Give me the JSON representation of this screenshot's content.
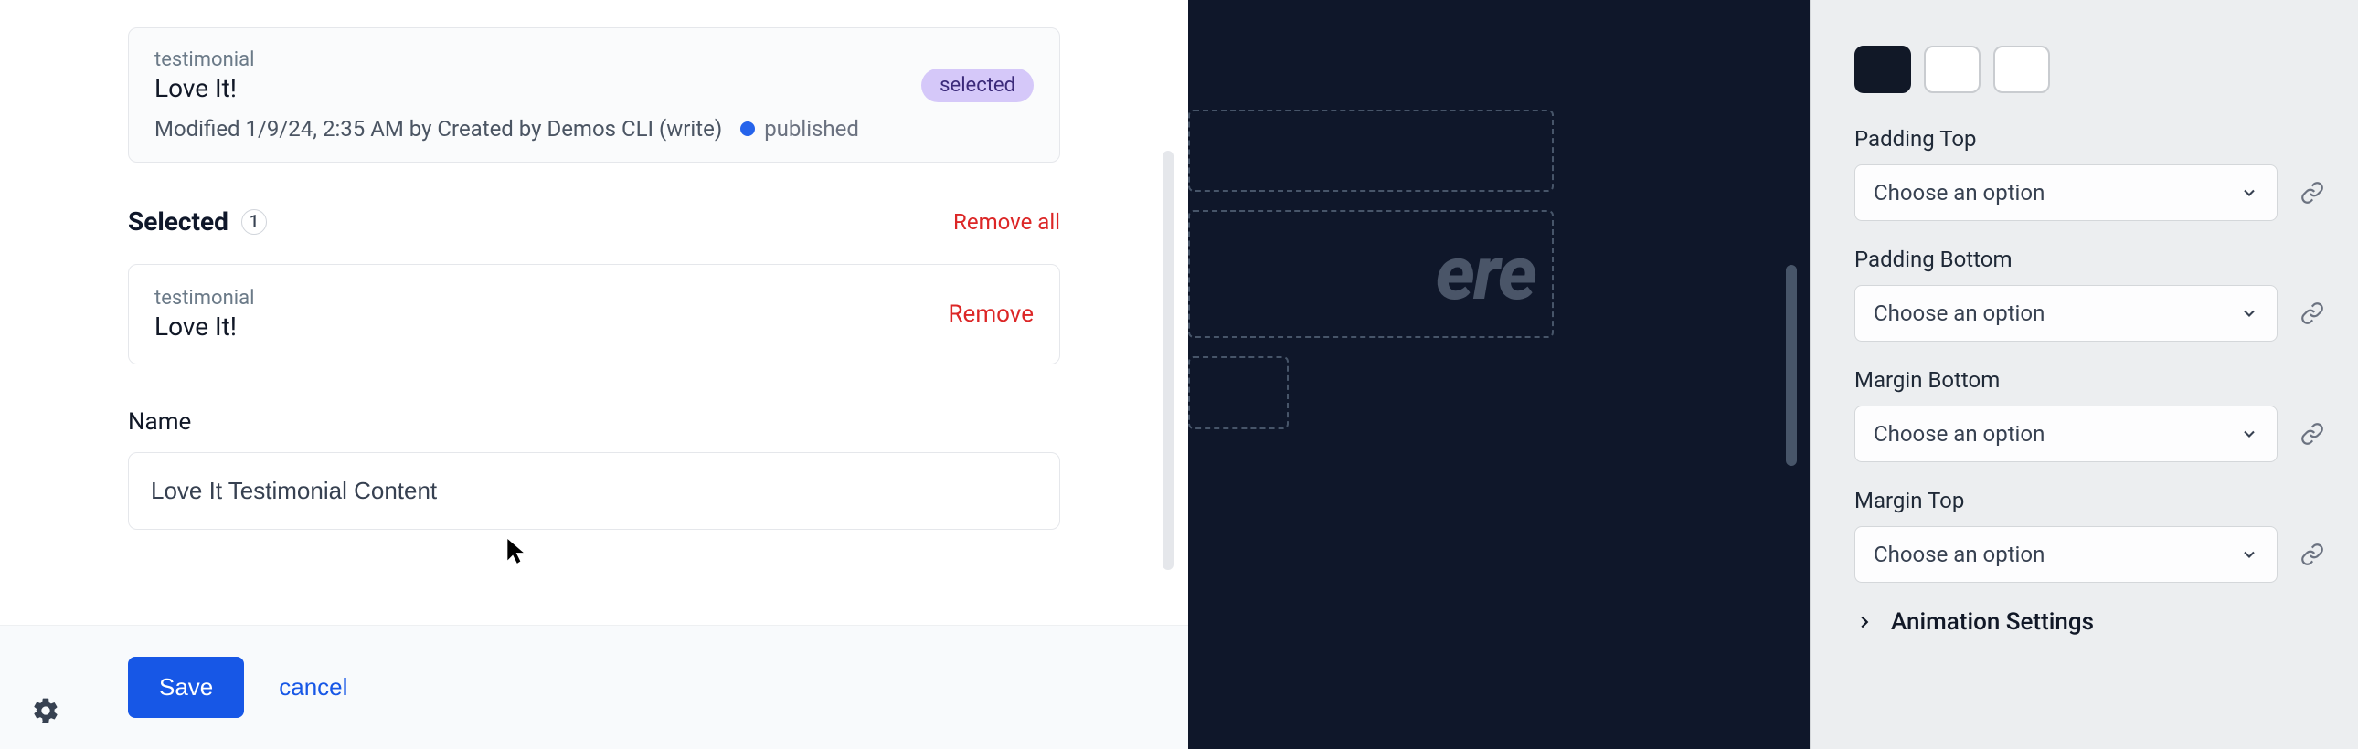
{
  "modal": {
    "result_card": {
      "tag": "testimonial",
      "title": "Love It!",
      "meta": "Modified 1/9/24, 2:35 AM by Created by Demos CLI (write)",
      "status_label": "published",
      "badge": "selected"
    },
    "selected_section": {
      "heading": "Selected",
      "count": "1",
      "remove_all": "Remove all"
    },
    "selected_item": {
      "tag": "testimonial",
      "title": "Love It!",
      "remove": "Remove"
    },
    "name_field": {
      "label": "Name",
      "value": "Love It Testimonial Content"
    },
    "footer": {
      "save": "Save",
      "cancel": "cancel"
    }
  },
  "canvas": {
    "placeholder": "ere"
  },
  "panel": {
    "swatches": [
      "dark",
      "light",
      "light"
    ],
    "props": [
      {
        "label": "Padding Top",
        "placeholder": "Choose an option"
      },
      {
        "label": "Padding Bottom",
        "placeholder": "Choose an option"
      },
      {
        "label": "Margin Bottom",
        "placeholder": "Choose an option"
      },
      {
        "label": "Margin Top",
        "placeholder": "Choose an option"
      }
    ],
    "accordion": "Animation Settings"
  }
}
